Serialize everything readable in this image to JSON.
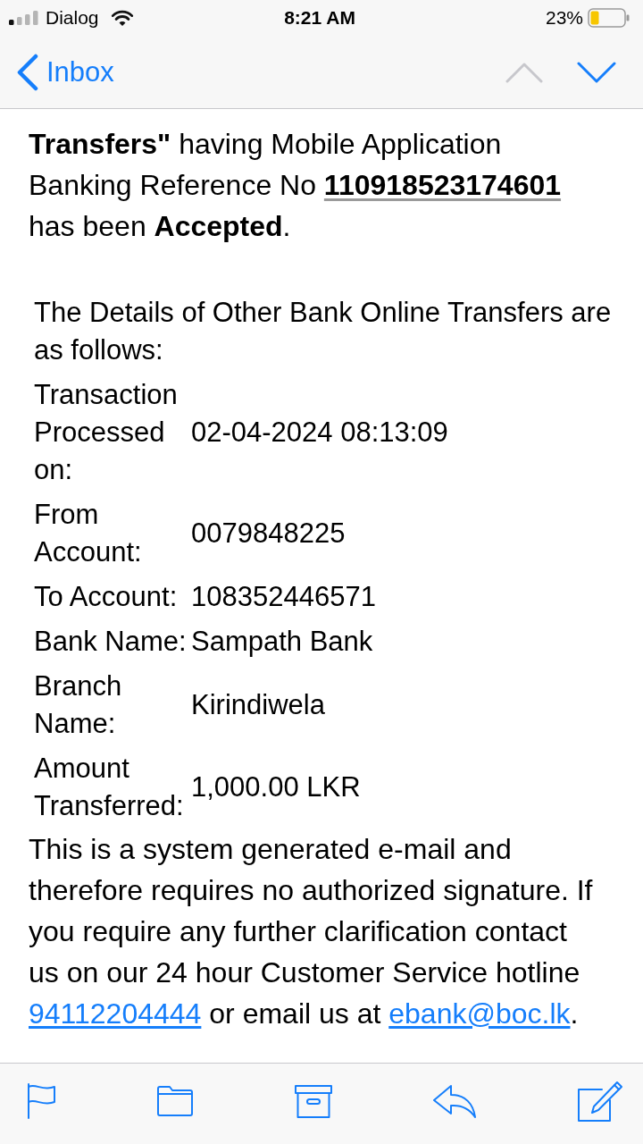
{
  "status_bar": {
    "carrier": "Dialog",
    "time": "8:21 AM",
    "battery": "23%"
  },
  "nav_bar": {
    "back_label": "Inbox",
    "buttons": [
      {
        "kind": "previous",
        "disabled": true
      },
      {
        "kind": "next",
        "disabled": false
      }
    ]
  },
  "message": {
    "intro": [
      {
        "kind": "text",
        "text": "**Transfers\"** having Mobile Application Banking Reference No "
      },
      {
        "kind": "reference",
        "text": "110918523174601"
      },
      {
        "kind": "text",
        "text": " has been **Accepted**."
      }
    ],
    "details_heading": "The Details of Other Bank Online Transfers are as follows:",
    "details": [
      {
        "label": "Transaction Processed on:",
        "value": "02-04-2024 08:13:09"
      },
      {
        "label": "From Account:",
        "value": "0079848225"
      },
      {
        "label": "To Account:",
        "value": "108352446571"
      },
      {
        "label": "Bank Name:",
        "value": "Sampath Bank"
      },
      {
        "label": "Branch Name:",
        "value": "Kirindiwela"
      },
      {
        "label": "Amount Transferred:",
        "value": "1,000.00 LKR"
      }
    ],
    "footer": [
      {
        "kind": "text",
        "text": "This is a system generated e-mail and therefore requires no authorized signature. If you require any further clarification contact us on our 24 hour Customer Service hotline "
      },
      {
        "kind": "phone",
        "text": "94112204444"
      },
      {
        "kind": "text",
        "text": " or email us at "
      },
      {
        "kind": "email",
        "text": "ebank@boc.lk"
      },
      {
        "kind": "text",
        "text": "."
      }
    ]
  }
}
